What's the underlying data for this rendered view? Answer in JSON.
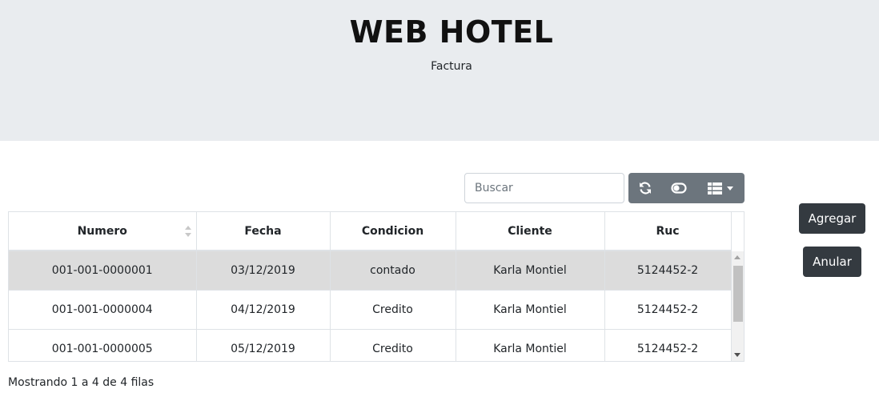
{
  "header": {
    "title": "WEB HOTEL",
    "subtitle": "Factura"
  },
  "toolbar": {
    "search_placeholder": "Buscar",
    "icons": [
      "refresh-icon",
      "toggle-icon",
      "columns-icon"
    ]
  },
  "table": {
    "columns": [
      "Numero",
      "Fecha",
      "Condicion",
      "Cliente",
      "Ruc"
    ],
    "rows": [
      [
        "001-001-0000001",
        "03/12/2019",
        "contado",
        "Karla Montiel",
        "5124452-2"
      ],
      [
        "001-001-0000004",
        "04/12/2019",
        "Credito",
        "Karla Montiel",
        "5124452-2"
      ],
      [
        "001-001-0000005",
        "05/12/2019",
        "Credito",
        "Karla Montiel",
        "5124452-2"
      ]
    ],
    "selected_row": 0
  },
  "pagination": {
    "info": "Mostrando 1 a 4 de 4 filas"
  },
  "actions": {
    "add_label": "Agregar",
    "cancel_label": "Anular"
  },
  "colors": {
    "header_bg": "#e9ecef",
    "toolbar_bg": "#6c757d",
    "action_bg": "#343a40",
    "selected_row_bg": "#dcdcdc"
  }
}
